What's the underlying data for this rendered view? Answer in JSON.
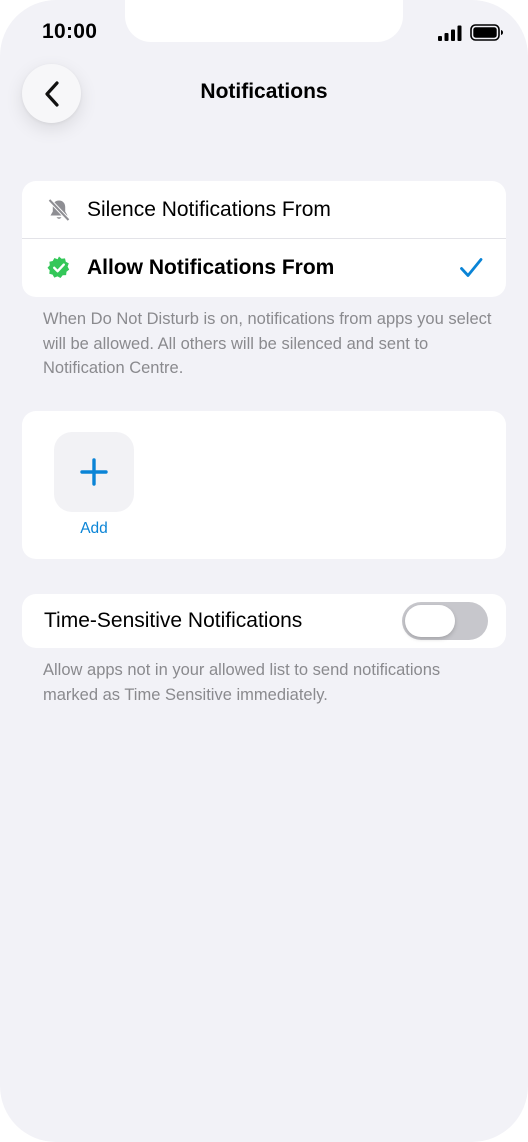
{
  "status_bar": {
    "time": "10:00"
  },
  "header": {
    "title": "Notifications",
    "back_icon": "chevron-left-icon"
  },
  "mode_options": {
    "items": [
      {
        "label": "Silence Notifications From",
        "icon": "bell-slash-icon",
        "selected": false
      },
      {
        "label": "Allow Notifications From",
        "icon": "green-check-badge-icon",
        "selected": true
      }
    ],
    "footnote": "When Do Not Disturb is on, notifications from apps you select will be allowed. All others will be silenced and sent to Notification Centre."
  },
  "apps": {
    "add_label": "Add",
    "add_icon": "plus-icon"
  },
  "time_sensitive": {
    "label": "Time-Sensitive Notifications",
    "enabled": false,
    "footnote": "Allow apps not in your allowed list to send notifications marked as Time Sensitive immediately."
  },
  "colors": {
    "accent": "#0a84d6",
    "success": "#34c759",
    "background": "#f2f2f7"
  }
}
